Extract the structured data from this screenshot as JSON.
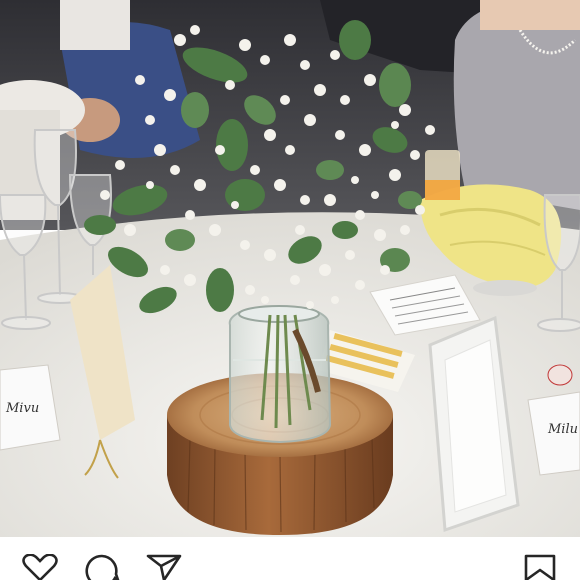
{
  "post": {
    "image_description_alt": "",
    "actions": [
      {
        "id": "like",
        "icon": "heart-icon"
      },
      {
        "id": "comment",
        "icon": "comment-icon"
      },
      {
        "id": "share",
        "icon": "send-icon"
      },
      {
        "id": "save",
        "icon": "bookmark-icon"
      }
    ]
  },
  "colors": {
    "tablecloth": "#efedea",
    "napkin_yellow": "#efe487",
    "wood_slice": "#a0663a",
    "wood_light": "#c99a67",
    "foliage": "#4d7a45",
    "babys_breath": "#f4f2ec",
    "icon_stroke": "#262626",
    "background_top": "#3b3b3f"
  },
  "table_cards": {
    "left_card_text": "Mivu",
    "right_card_text": "Milu"
  }
}
